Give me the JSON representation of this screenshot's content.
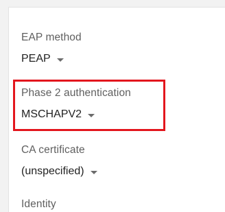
{
  "fields": {
    "eap_method": {
      "label": "EAP method",
      "value": "PEAP"
    },
    "phase2_auth": {
      "label": "Phase 2 authentication",
      "value": "MSCHAPV2"
    },
    "ca_certificate": {
      "label": "CA certificate",
      "value": "(unspecified)"
    },
    "identity": {
      "label": "Identity"
    }
  },
  "icons": {
    "dropdown": "dropdown-arrow-icon"
  },
  "colors": {
    "highlight": "#e3161d",
    "label": "#5f5f5f",
    "value": "#222222",
    "background": "#f2f2f2",
    "panel": "#ffffff"
  }
}
